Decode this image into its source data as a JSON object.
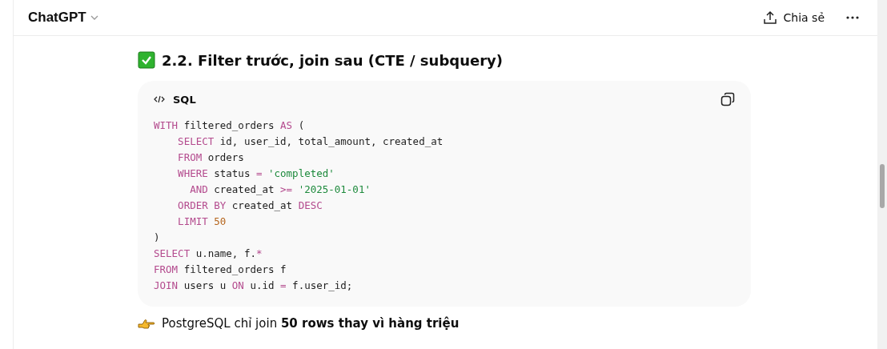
{
  "header": {
    "title": "ChatGPT",
    "share": "Chia sẻ"
  },
  "heading": "2.2. Filter trước, join sau (CTE / subquery)",
  "code_block": {
    "language": "SQL",
    "lines": [
      [
        {
          "kind": "kw",
          "text": "WITH"
        },
        {
          "kind": "plain",
          "text": " filtered_orders "
        },
        {
          "kind": "kw",
          "text": "AS"
        },
        {
          "kind": "plain",
          "text": " ("
        }
      ],
      [
        {
          "kind": "kw",
          "text": "    SELECT"
        },
        {
          "kind": "plain",
          "text": " id, user_id, total_amount, created_at"
        }
      ],
      [
        {
          "kind": "kw",
          "text": "    FROM"
        },
        {
          "kind": "plain",
          "text": " orders"
        }
      ],
      [
        {
          "kind": "kw",
          "text": "    WHERE"
        },
        {
          "kind": "plain",
          "text": " status "
        },
        {
          "kind": "kw",
          "text": "="
        },
        {
          "kind": "str",
          "text": " 'completed'"
        }
      ],
      [
        {
          "kind": "kw",
          "text": "      AND"
        },
        {
          "kind": "plain",
          "text": " created_at "
        },
        {
          "kind": "kw",
          "text": ">="
        },
        {
          "kind": "str",
          "text": " '2025-01-01'"
        }
      ],
      [
        {
          "kind": "kw",
          "text": "    ORDER BY"
        },
        {
          "kind": "plain",
          "text": " created_at "
        },
        {
          "kind": "kw",
          "text": "DESC"
        }
      ],
      [
        {
          "kind": "kw",
          "text": "    LIMIT"
        },
        {
          "kind": "num",
          "text": " 50"
        }
      ],
      [
        {
          "kind": "plain",
          "text": ")"
        }
      ],
      [
        {
          "kind": "kw",
          "text": "SELECT"
        },
        {
          "kind": "plain",
          "text": " u.name, f."
        },
        {
          "kind": "kw",
          "text": "*"
        }
      ],
      [
        {
          "kind": "kw",
          "text": "FROM"
        },
        {
          "kind": "plain",
          "text": " filtered_orders f"
        }
      ],
      [
        {
          "kind": "kw",
          "text": "JOIN"
        },
        {
          "kind": "plain",
          "text": " users u "
        },
        {
          "kind": "kw",
          "text": "ON"
        },
        {
          "kind": "plain",
          "text": " u.id "
        },
        {
          "kind": "kw",
          "text": "="
        },
        {
          "kind": "plain",
          "text": " f.user_id;"
        }
      ]
    ]
  },
  "note": "PostgreSQL chỉ join **50 rows thay vì hàng triệu**"
}
